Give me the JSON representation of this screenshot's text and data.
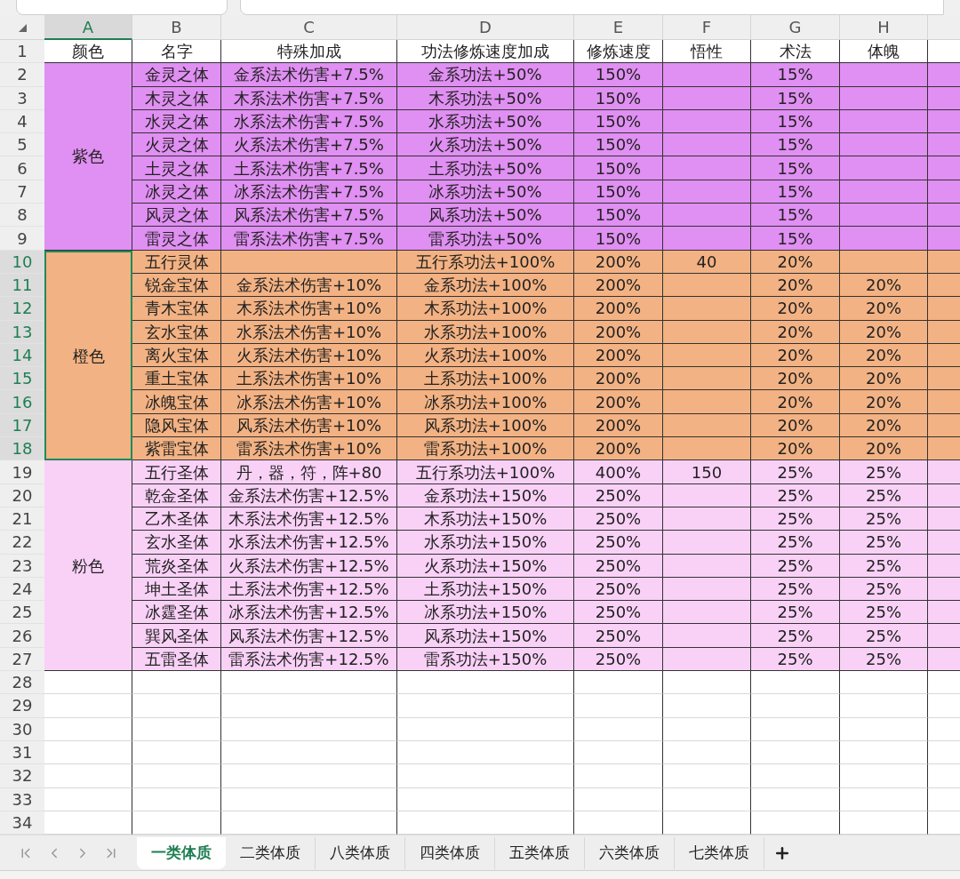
{
  "columns": [
    {
      "label": "A",
      "selected": true
    },
    {
      "label": "B",
      "selected": false
    },
    {
      "label": "C",
      "selected": false
    },
    {
      "label": "D",
      "selected": false
    },
    {
      "label": "E",
      "selected": false
    },
    {
      "label": "F",
      "selected": false
    },
    {
      "label": "G",
      "selected": false
    },
    {
      "label": "H",
      "selected": false
    }
  ],
  "row_numbers": [
    {
      "label": "1",
      "selected": false
    },
    {
      "label": "2",
      "selected": false
    },
    {
      "label": "3",
      "selected": false
    },
    {
      "label": "4",
      "selected": false
    },
    {
      "label": "5",
      "selected": false
    },
    {
      "label": "6",
      "selected": false
    },
    {
      "label": "7",
      "selected": false
    },
    {
      "label": "8",
      "selected": false
    },
    {
      "label": "9",
      "selected": false
    },
    {
      "label": "10",
      "selected": true
    },
    {
      "label": "11",
      "selected": true
    },
    {
      "label": "12",
      "selected": true
    },
    {
      "label": "13",
      "selected": true
    },
    {
      "label": "14",
      "selected": true
    },
    {
      "label": "15",
      "selected": true
    },
    {
      "label": "16",
      "selected": true
    },
    {
      "label": "17",
      "selected": true
    },
    {
      "label": "18",
      "selected": true
    },
    {
      "label": "19",
      "selected": false
    },
    {
      "label": "20",
      "selected": false
    },
    {
      "label": "21",
      "selected": false
    },
    {
      "label": "22",
      "selected": false
    },
    {
      "label": "23",
      "selected": false
    },
    {
      "label": "24",
      "selected": false
    },
    {
      "label": "25",
      "selected": false
    },
    {
      "label": "26",
      "selected": false
    },
    {
      "label": "27",
      "selected": false
    },
    {
      "label": "28",
      "selected": false
    },
    {
      "label": "29",
      "selected": false
    },
    {
      "label": "30",
      "selected": false
    },
    {
      "label": "31",
      "selected": false
    },
    {
      "label": "32",
      "selected": false
    },
    {
      "label": "33",
      "selected": false
    },
    {
      "label": "34",
      "selected": false
    }
  ],
  "header_row": [
    "颜色",
    "名字",
    "特殊加成",
    "功法修炼速度加成",
    "修炼速度",
    "悟性",
    "术法",
    "体魄"
  ],
  "groups": [
    {
      "label": "紫色",
      "color": "#e08ff2",
      "selected": false,
      "rows": [
        {
          "name": "金灵之体",
          "special": "金系法术伤害+7.5%",
          "skill_speed": "金系功法+50%",
          "speed": "150%",
          "spell": "15%"
        },
        {
          "name": "木灵之体",
          "special": "木系法术伤害+7.5%",
          "skill_speed": "木系功法+50%",
          "speed": "150%",
          "spell": "15%"
        },
        {
          "name": "水灵之体",
          "special": "水系法术伤害+7.5%",
          "skill_speed": "水系功法+50%",
          "speed": "150%",
          "spell": "15%"
        },
        {
          "name": "火灵之体",
          "special": "火系法术伤害+7.5%",
          "skill_speed": "火系功法+50%",
          "speed": "150%",
          "spell": "15%"
        },
        {
          "name": "土灵之体",
          "special": "土系法术伤害+7.5%",
          "skill_speed": "土系功法+50%",
          "speed": "150%",
          "spell": "15%"
        },
        {
          "name": "冰灵之体",
          "special": "冰系法术伤害+7.5%",
          "skill_speed": "冰系功法+50%",
          "speed": "150%",
          "spell": "15%"
        },
        {
          "name": "风灵之体",
          "special": "风系法术伤害+7.5%",
          "skill_speed": "风系功法+50%",
          "speed": "150%",
          "spell": "15%"
        },
        {
          "name": "雷灵之体",
          "special": "雷系法术伤害+7.5%",
          "skill_speed": "雷系功法+50%",
          "speed": "150%",
          "spell": "15%"
        }
      ]
    },
    {
      "label": "橙色",
      "color": "#f3b283",
      "selected": true,
      "rows": [
        {
          "name": "五行灵体",
          "skill_speed": "五行系功法+100%",
          "speed": "200%",
          "insight": "40",
          "spell": "20%"
        },
        {
          "name": "锐金宝体",
          "special": "金系法术伤害+10%",
          "skill_speed": "金系功法+100%",
          "speed": "200%",
          "spell": "20%",
          "body": "20%"
        },
        {
          "name": "青木宝体",
          "special": "木系法术伤害+10%",
          "skill_speed": "木系功法+100%",
          "speed": "200%",
          "spell": "20%",
          "body": "20%"
        },
        {
          "name": "玄水宝体",
          "special": "水系法术伤害+10%",
          "skill_speed": "水系功法+100%",
          "speed": "200%",
          "spell": "20%",
          "body": "20%"
        },
        {
          "name": "离火宝体",
          "special": "火系法术伤害+10%",
          "skill_speed": "火系功法+100%",
          "speed": "200%",
          "spell": "20%",
          "body": "20%"
        },
        {
          "name": "重土宝体",
          "special": "土系法术伤害+10%",
          "skill_speed": "土系功法+100%",
          "speed": "200%",
          "spell": "20%",
          "body": "20%"
        },
        {
          "name": "冰魄宝体",
          "special": "冰系法术伤害+10%",
          "skill_speed": "冰系功法+100%",
          "speed": "200%",
          "spell": "20%",
          "body": "20%"
        },
        {
          "name": "隐风宝体",
          "special": "风系法术伤害+10%",
          "skill_speed": "风系功法+100%",
          "speed": "200%",
          "spell": "20%",
          "body": "20%"
        },
        {
          "name": "紫雷宝体",
          "special": "雷系法术伤害+10%",
          "skill_speed": "雷系功法+100%",
          "speed": "200%",
          "spell": "20%",
          "body": "20%"
        }
      ]
    },
    {
      "label": "粉色",
      "color": "#f9d1f7",
      "selected": false,
      "rows": [
        {
          "name": "五行圣体",
          "special": "丹，器，符，阵+80",
          "skill_speed": "五行系功法+100%",
          "speed": "400%",
          "insight": "150",
          "spell": "25%",
          "body": "25%"
        },
        {
          "name": "乾金圣体",
          "special": "金系法术伤害+12.5%",
          "skill_speed": "金系功法+150%",
          "speed": "250%",
          "spell": "25%",
          "body": "25%"
        },
        {
          "name": "乙木圣体",
          "special": "木系法术伤害+12.5%",
          "skill_speed": "木系功法+150%",
          "speed": "250%",
          "spell": "25%",
          "body": "25%"
        },
        {
          "name": "玄水圣体",
          "special": "水系法术伤害+12.5%",
          "skill_speed": "水系功法+150%",
          "speed": "250%",
          "spell": "25%",
          "body": "25%"
        },
        {
          "name": "荒炎圣体",
          "special": "火系法术伤害+12.5%",
          "skill_speed": "火系功法+150%",
          "speed": "250%",
          "spell": "25%",
          "body": "25%"
        },
        {
          "name": "坤土圣体",
          "special": "土系法术伤害+12.5%",
          "skill_speed": "土系功法+150%",
          "speed": "250%",
          "spell": "25%",
          "body": "25%"
        },
        {
          "name": "冰霆圣体",
          "special": "冰系法术伤害+12.5%",
          "skill_speed": "冰系功法+150%",
          "speed": "250%",
          "spell": "25%",
          "body": "25%"
        },
        {
          "name": "巽风圣体",
          "special": "风系法术伤害+12.5%",
          "skill_speed": "风系功法+150%",
          "speed": "250%",
          "spell": "25%",
          "body": "25%"
        },
        {
          "name": "五雷圣体",
          "special": "雷系法术伤害+12.5%",
          "skill_speed": "雷系功法+150%",
          "speed": "250%",
          "spell": "25%",
          "body": "25%"
        }
      ]
    }
  ],
  "sheet_tabs": [
    {
      "label": "一类体质",
      "selected": true
    },
    {
      "label": "二类体质",
      "selected": false
    },
    {
      "label": "八类体质",
      "selected": false
    },
    {
      "label": "四类体质",
      "selected": false
    },
    {
      "label": "五类体质",
      "selected": false
    },
    {
      "label": "六类体质",
      "selected": false
    },
    {
      "label": "七类体质",
      "selected": false
    }
  ]
}
